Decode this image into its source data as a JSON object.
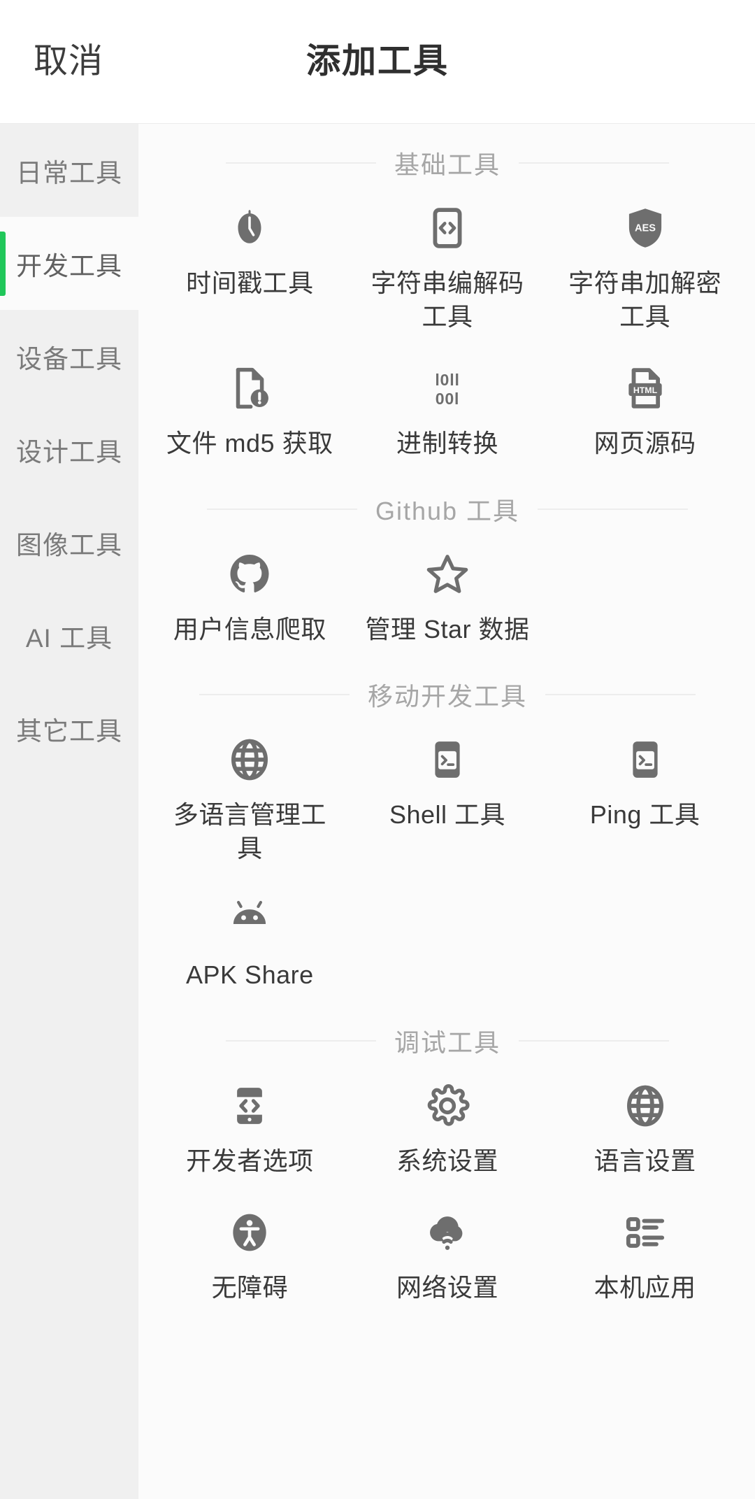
{
  "header": {
    "cancel_label": "取消",
    "title": "添加工具"
  },
  "colors": {
    "accent_green": "#20c75a",
    "icon_gray": "#6e6e6e",
    "label_gray": "#3a3a3a",
    "section_title_gray": "#a6a6a6",
    "sidebar_bg": "#f0f0f0",
    "content_bg": "#fbfbfb"
  },
  "sidebar": {
    "items": [
      {
        "label": "日常工具",
        "active": false
      },
      {
        "label": "开发工具",
        "active": true
      },
      {
        "label": "设备工具",
        "active": false
      },
      {
        "label": "设计工具",
        "active": false
      },
      {
        "label": "图像工具",
        "active": false
      },
      {
        "label": "AI 工具",
        "active": false
      },
      {
        "label": "其它工具",
        "active": false
      }
    ]
  },
  "sections": [
    {
      "title": "基础工具",
      "tools": [
        {
          "label": "时间戳工具",
          "icon": "clock-icon"
        },
        {
          "label": "字符串编解码工具",
          "icon": "code-phone-icon"
        },
        {
          "label": "字符串加解密工具",
          "icon": "aes-shield-icon"
        },
        {
          "label": "文件 md5 获取",
          "icon": "file-alert-icon"
        },
        {
          "label": "进制转换",
          "icon": "binary-icon"
        },
        {
          "label": "网页源码",
          "icon": "html-file-icon"
        }
      ]
    },
    {
      "title": "Github 工具",
      "tools": [
        {
          "label": "用户信息爬取",
          "icon": "github-icon"
        },
        {
          "label": "管理 Star 数据",
          "icon": "star-outline-icon"
        }
      ]
    },
    {
      "title": "移动开发工具",
      "tools": [
        {
          "label": "多语言管理工具",
          "icon": "globe-icon"
        },
        {
          "label": "Shell 工具",
          "icon": "terminal-phone-icon"
        },
        {
          "label": "Ping 工具",
          "icon": "terminal-phone-icon"
        },
        {
          "label": "APK Share",
          "icon": "android-icon"
        }
      ]
    },
    {
      "title": "调试工具",
      "tools": [
        {
          "label": "开发者选项",
          "icon": "phone-code-icon"
        },
        {
          "label": "系统设置",
          "icon": "gear-icon"
        },
        {
          "label": "语言设置",
          "icon": "globe-icon"
        },
        {
          "label": "无障碍",
          "icon": "accessibility-icon"
        },
        {
          "label": "网络设置",
          "icon": "cloud-wifi-icon"
        },
        {
          "label": "本机应用",
          "icon": "app-list-icon"
        }
      ]
    }
  ]
}
